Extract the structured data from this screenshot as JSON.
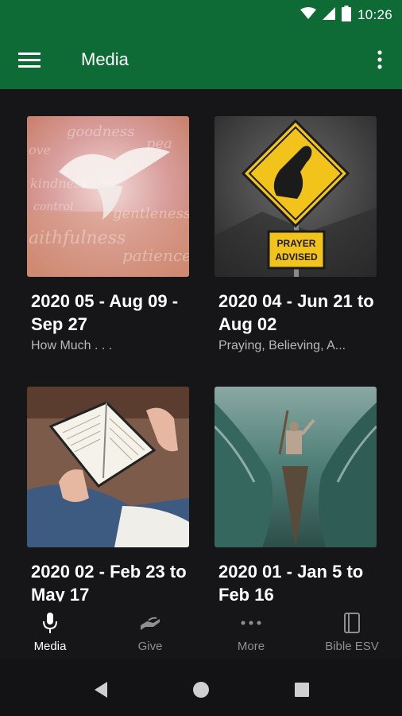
{
  "status_bar": {
    "time": "10:26"
  },
  "app_bar": {
    "title": "Media"
  },
  "colors": {
    "primary": "#0e6b35",
    "background": "#161618",
    "subtitle": "#b9b9b9",
    "nav_inactive": "#8f8f8f"
  },
  "media_items": [
    {
      "title": "2020 05 - Aug 09 - Sep 27",
      "subtitle": "How Much . . .",
      "image": "dove-fruit-of-spirit"
    },
    {
      "title": "2020 04 - Jun 21 to Aug 02",
      "subtitle": "Praying, Believing, A...",
      "image": "prayer-advised-sign"
    },
    {
      "title": "2020 02 - Feb 23 to May 17",
      "subtitle": "",
      "image": "person-reading-bible"
    },
    {
      "title": "2020 01 - Jan 5 to Feb 16",
      "subtitle": "",
      "image": "moses-parting-sea"
    }
  ],
  "sign_text": {
    "line1": "PRAYER",
    "line2": "ADVISED"
  },
  "bottom_nav": [
    {
      "label": "Media",
      "icon": "microphone-icon",
      "active": true
    },
    {
      "label": "Give",
      "icon": "give-hand-icon",
      "active": false
    },
    {
      "label": "More",
      "icon": "more-dots-icon",
      "active": false
    },
    {
      "label": "Bible ESV",
      "icon": "bible-book-icon",
      "active": false
    }
  ],
  "system_nav": [
    "back-icon",
    "home-icon",
    "recents-icon"
  ]
}
